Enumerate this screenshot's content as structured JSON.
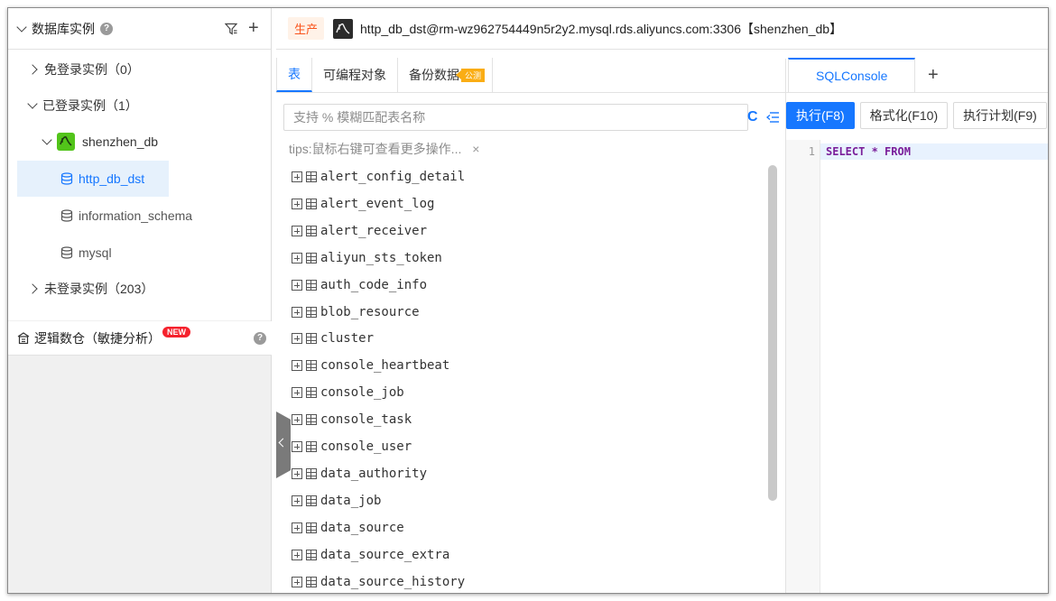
{
  "sidebar": {
    "header_title": "数据库实例",
    "help_glyph": "?",
    "plus_glyph": "+",
    "tree": {
      "login_free": "免登录实例（0）",
      "logged_in": "已登录实例（1）",
      "instance": "shenzhen_db",
      "databases": [
        "http_db_dst",
        "information_schema",
        "mysql"
      ],
      "not_logged_in": "未登录实例（203）"
    },
    "logic_warehouse": "逻辑数仓（敏捷分析）",
    "new_badge": "NEW"
  },
  "topbar": {
    "env_tag": "生产",
    "connection": "http_db_dst@rm-wz962754449n5r2y2.mysql.rds.aliyuncs.com:3306【shenzhen_db】"
  },
  "midpanel": {
    "tabs": [
      "表",
      "可编程对象",
      "备份数据"
    ],
    "beta_badge": "公测",
    "search_placeholder": "支持 % 模糊匹配表名称",
    "refresh_glyph": "C",
    "tips": "tips:鼠标右键可查看更多操作...",
    "tips_close": "×",
    "tables": [
      "alert_config_detail",
      "alert_event_log",
      "alert_receiver",
      "aliyun_sts_token",
      "auth_code_info",
      "blob_resource",
      "cluster",
      "console_heartbeat",
      "console_job",
      "console_task",
      "console_user",
      "data_authority",
      "data_job",
      "data_source",
      "data_source_extra",
      "data_source_history"
    ]
  },
  "console": {
    "tab": "SQLConsole",
    "plus_glyph": "+",
    "buttons": [
      "执行(F8)",
      "格式化(F10)",
      "执行计划(F9)"
    ],
    "line_number": "1",
    "code": "SELECT * FROM"
  },
  "colors": {
    "accent": "#1677ff",
    "env_tag": "#fa541c",
    "mysql_green": "#52c41a",
    "sql_keyword": "#7a1e9a"
  }
}
